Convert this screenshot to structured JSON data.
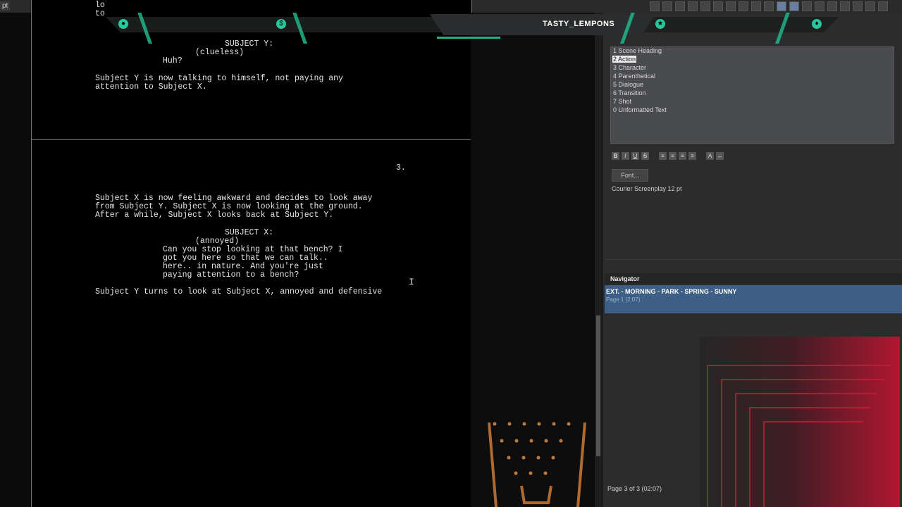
{
  "app": {
    "tab_label": "pt"
  },
  "overlay": {
    "streamer": "TASTY_LEMPONS"
  },
  "script": {
    "page1_lines": [
      "lo",
      "to",
      "SUBJECT Y:",
      "(clueless)",
      "Huh?",
      "Subject Y is now talking to himself, not paying any",
      "attention to Subject X."
    ],
    "page_number": "3.",
    "page2_lines": [
      "Subject X is now feeling awkward and decides to look away",
      "from Subject Y. Subject X is now looking at the ground.",
      "After a while, Subject X looks back at Subject Y.",
      "SUBJECT X:",
      "(annoyed)",
      "Can you stop looking at that bench? I",
      "got you here so that we can talk..",
      "here.. in nature. And you're just",
      "paying attention to a bench?",
      "Subject Y turns to look at Subject X, annoyed and defensive"
    ]
  },
  "elements": {
    "items": [
      "1 Scene Heading",
      "2 Action",
      "3 Character",
      "4 Parenthetical",
      "5 Dialogue",
      "6 Transition",
      "7 Shot",
      "0 Unformatted Text"
    ],
    "selected_index": 1
  },
  "format": {
    "bold": "B",
    "italic": "I",
    "underline": "U",
    "strike": "S",
    "font_button": "Font...",
    "font_info": "Courier Screenplay 12 pt"
  },
  "navigator": {
    "title": "Navigator",
    "scene": "EXT. - MORNING - PARK - SPRING - SUNNY",
    "scene_sub": "Page 1 (2:07)"
  },
  "status": {
    "page": "Page 3 of 3 (02:07)"
  }
}
